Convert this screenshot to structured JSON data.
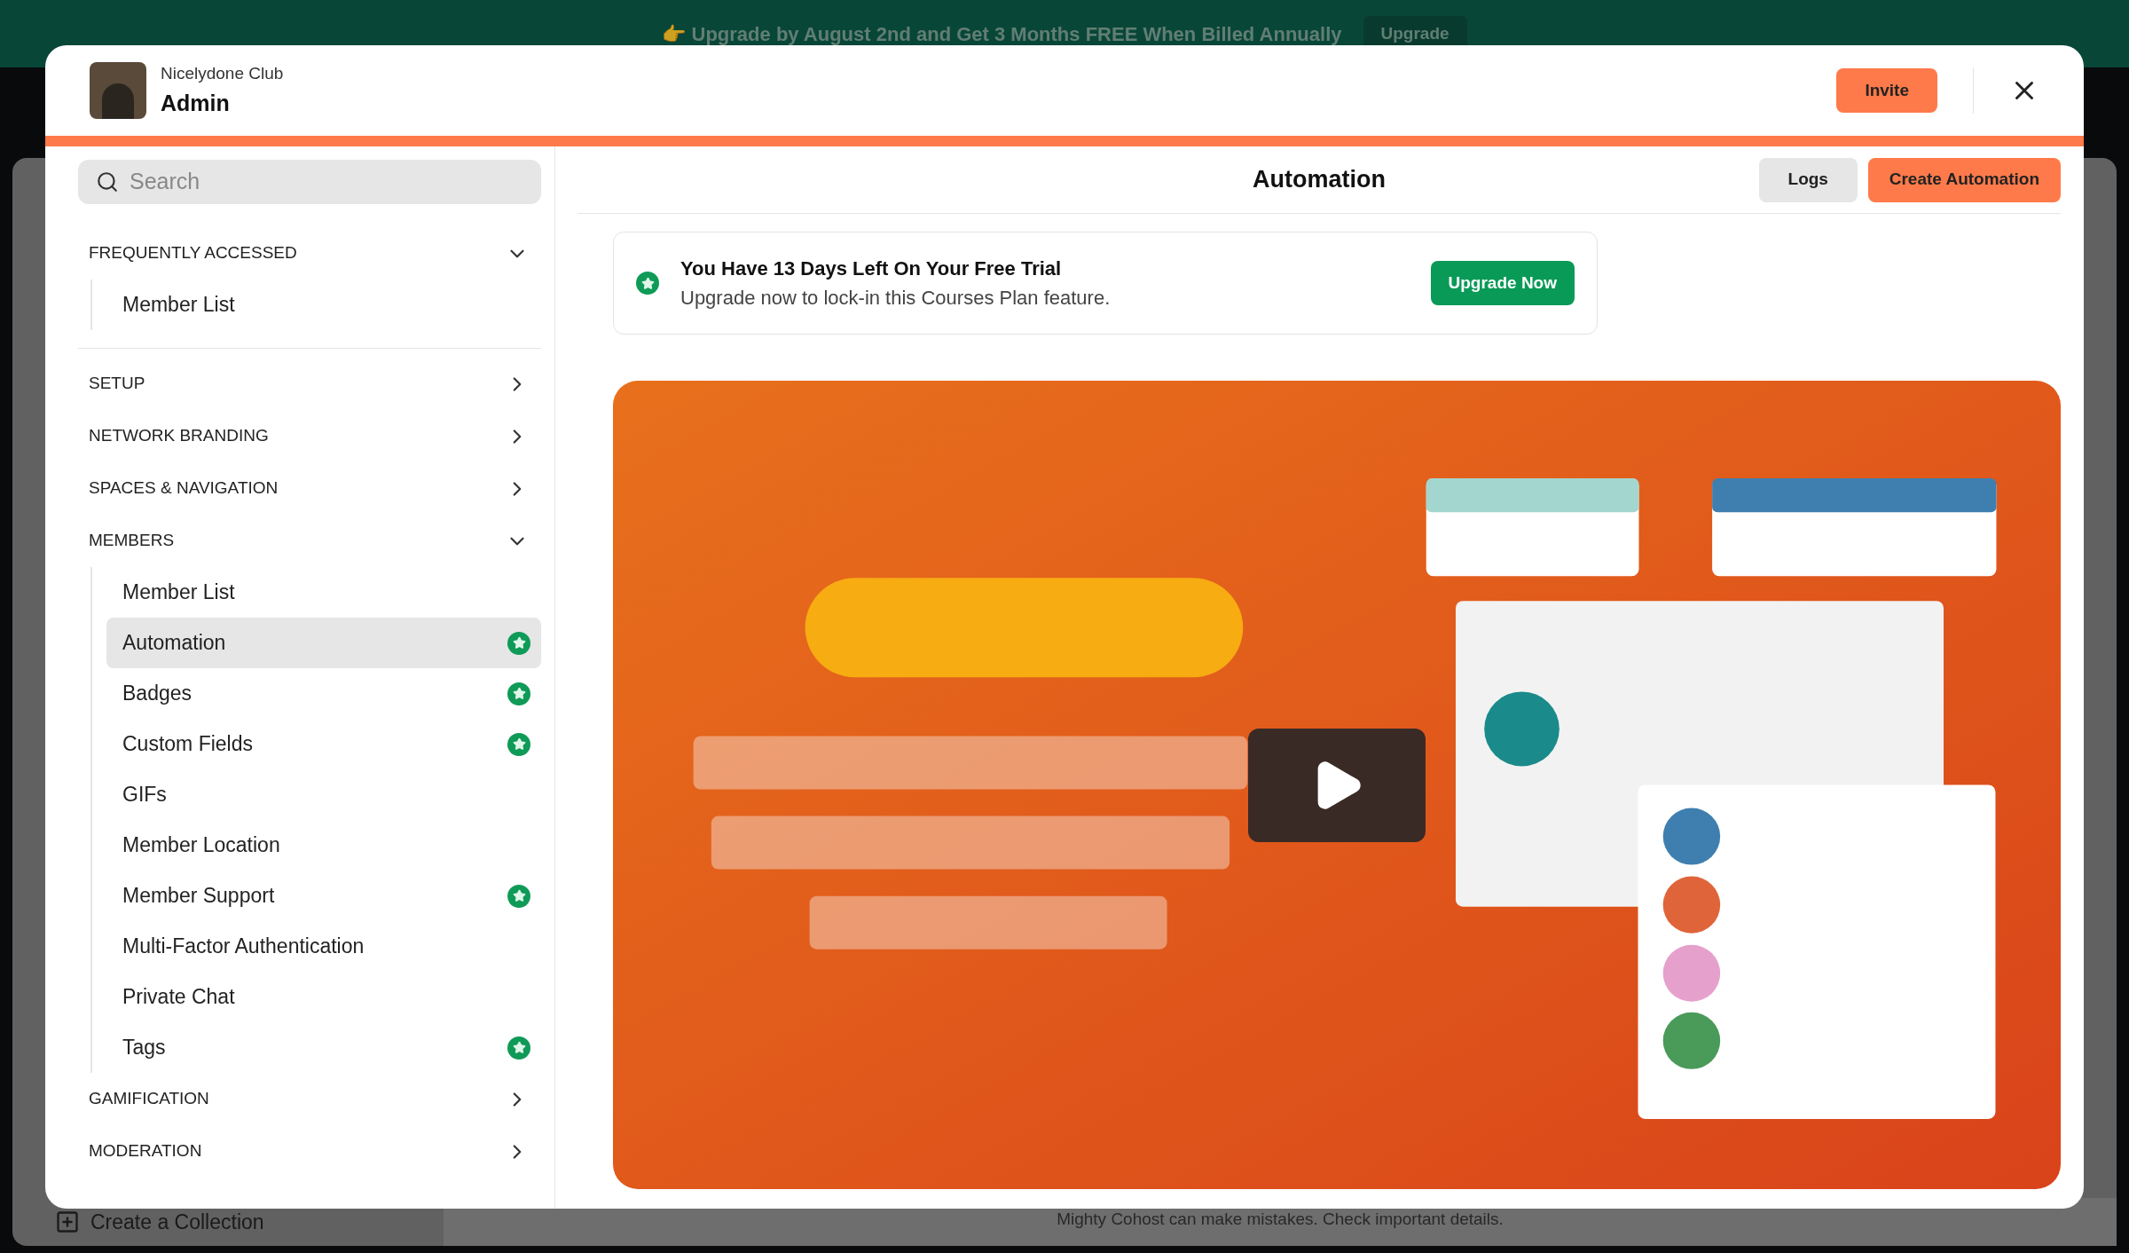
{
  "banner": {
    "text": "👉 Upgrade by August 2nd and Get 3 Months FREE When Billed Annually",
    "button": "Upgrade"
  },
  "background": {
    "create_collection": "Create a Collection",
    "disclaimer": "Mighty Cohost can make mistakes. Check important details."
  },
  "modal": {
    "network": "Nicelydone Club",
    "title": "Admin",
    "invite": "Invite"
  },
  "sidebar": {
    "search": {
      "placeholder": "Search"
    },
    "sections": [
      {
        "label": "FREQUENTLY ACCESSED",
        "expanded": true,
        "items": [
          {
            "label": "Member List",
            "selected": false,
            "starred": false
          }
        ]
      },
      {
        "label": "SETUP",
        "expanded": false
      },
      {
        "label": "NETWORK BRANDING",
        "expanded": false
      },
      {
        "label": "SPACES & NAVIGATION",
        "expanded": false
      },
      {
        "label": "MEMBERS",
        "expanded": true,
        "items": [
          {
            "label": "Member List",
            "selected": false,
            "starred": false
          },
          {
            "label": "Automation",
            "selected": true,
            "starred": true
          },
          {
            "label": "Badges",
            "selected": false,
            "starred": true
          },
          {
            "label": "Custom Fields",
            "selected": false,
            "starred": true
          },
          {
            "label": "GIFs",
            "selected": false,
            "starred": false
          },
          {
            "label": "Member Location",
            "selected": false,
            "starred": false
          },
          {
            "label": "Member Support",
            "selected": false,
            "starred": true
          },
          {
            "label": "Multi-Factor Authentication",
            "selected": false,
            "starred": false
          },
          {
            "label": "Private Chat",
            "selected": false,
            "starred": false
          },
          {
            "label": "Tags",
            "selected": false,
            "starred": true
          }
        ]
      },
      {
        "label": "GAMIFICATION",
        "expanded": false
      },
      {
        "label": "MODERATION",
        "expanded": false
      }
    ]
  },
  "main": {
    "title": "Automation",
    "buttons": [
      "Logs",
      "Create Automation"
    ],
    "trial": {
      "title": "You Have 13 Days Left On Your Free Trial",
      "text": "Upgrade now to lock-in this Courses Plan feature.",
      "button": "Upgrade Now"
    }
  }
}
